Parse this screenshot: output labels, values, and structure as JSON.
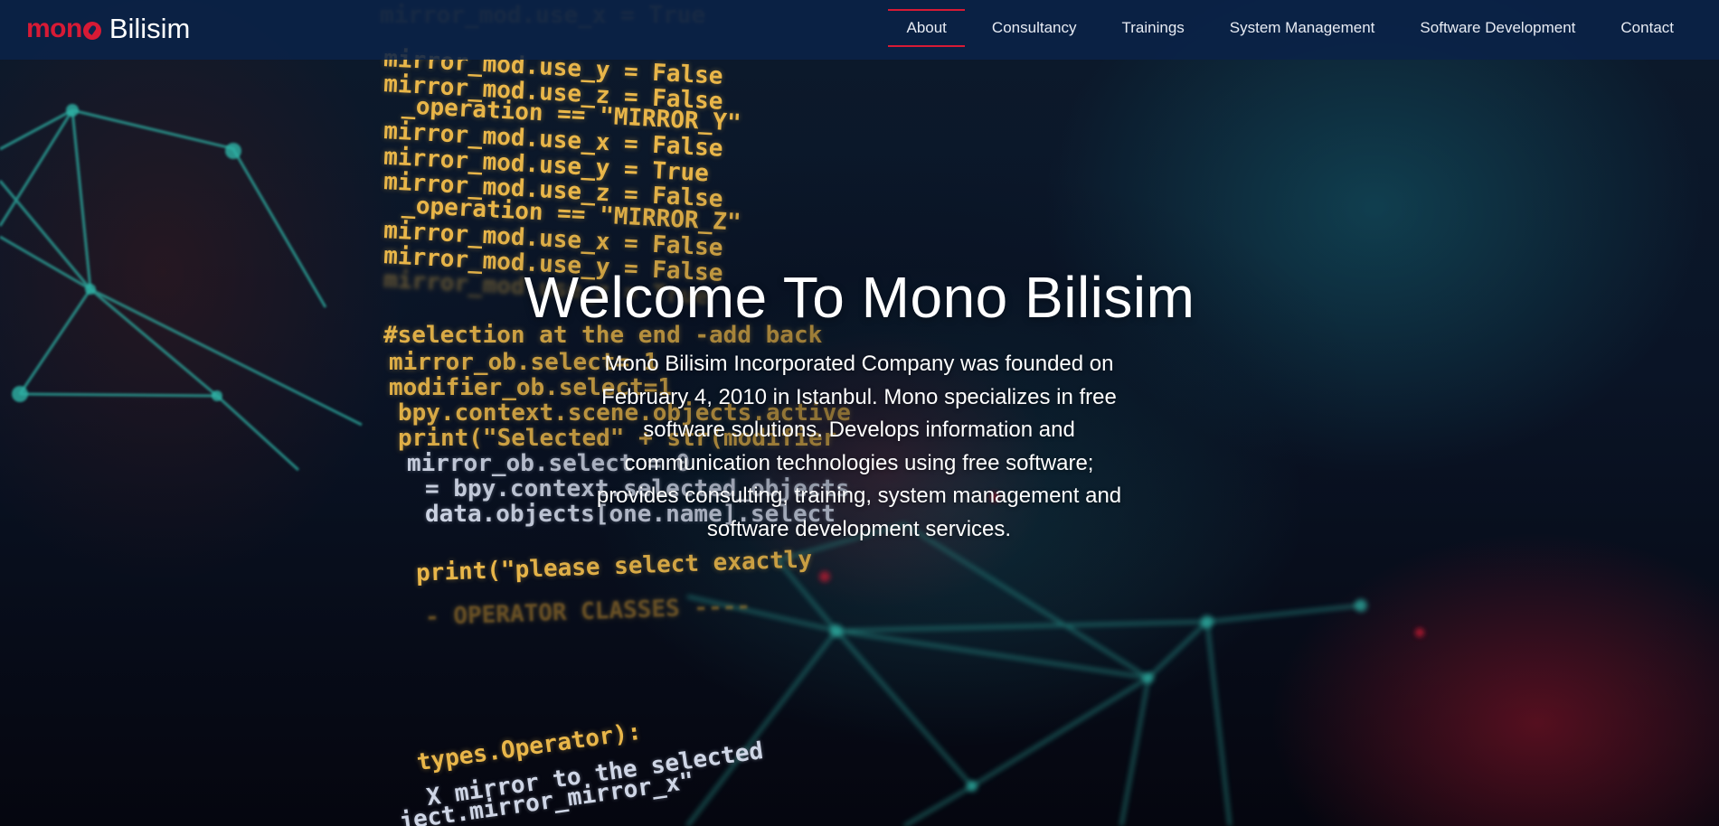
{
  "brand": {
    "logo_mono": "mono",
    "logo_word": "Bilisim"
  },
  "nav": {
    "items": [
      {
        "label": "About",
        "active": true
      },
      {
        "label": "Consultancy",
        "active": false
      },
      {
        "label": "Trainings",
        "active": false
      },
      {
        "label": "System Management",
        "active": false
      },
      {
        "label": "Software Development",
        "active": false
      },
      {
        "label": "Contact",
        "active": false
      }
    ]
  },
  "hero": {
    "title": "Welcome To Mono Bilisim",
    "description": "Mono Bilisim Incorporated Company was founded on February 4, 2010 in Istanbul. Mono specializes in free software solutions. Develops information and communication technologies using free software; provides consulting, training, system management and software development services.",
    "background_code_lines": [
      "mirror_mod.use_x = True",
      "mirror_mod.use_y = False",
      "mirror_mod.use_z = False",
      "_operation == \"MIRROR_Y\"",
      "mirror_mod.use_x = False",
      "mirror_mod.use_y = True",
      "mirror_mod.use_z = False",
      "_operation == \"MIRROR_Z\"",
      "mirror_mod.use_x = False",
      "mirror_mod.use_y = False",
      "mirror_mod.use_z = True",
      "#selection at the end -add back",
      "mirror_ob.select= 1",
      "modifier_ob.select=1",
      "bpy.context.scene.objects.active",
      "print(\"Selected\" + str(modifier",
      "mirror_ob.select = 0",
      "= bpy.context.selected_objects",
      "data.objects[one.name].select",
      "print(\"please select exactly",
      "- OPERATOR CLASSES ----",
      "types.Operator):",
      "X mirror to the selected",
      "ject.mirror_mirror_x\""
    ]
  },
  "colors": {
    "accent_red": "#d71a35",
    "navbar_bg": "#0a2248",
    "code_amber": "#e9b649",
    "network_teal": "#2fb3a6"
  }
}
